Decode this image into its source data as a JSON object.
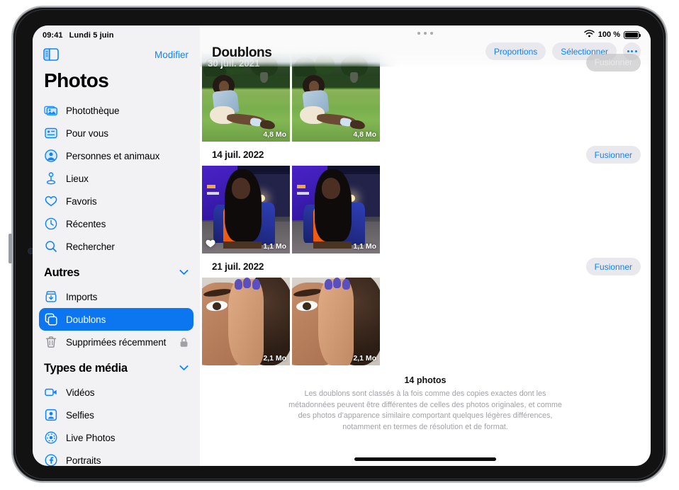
{
  "status_bar": {
    "time": "09:41",
    "date": "Lundi 5 juin",
    "battery_percent": "100 %",
    "wifi_icon": "wifi-icon",
    "battery_icon": "battery-icon"
  },
  "sidebar": {
    "toggle_icon": "sidebar-toggle-icon",
    "edit_label": "Modifier",
    "title": "Photos",
    "items": [
      {
        "label": "Photothèque",
        "icon": "photo-stack-icon",
        "selected": false
      },
      {
        "label": "Pour vous",
        "icon": "for-you-icon",
        "selected": false
      },
      {
        "label": "Personnes et animaux",
        "icon": "person-circle-icon",
        "selected": false
      },
      {
        "label": "Lieux",
        "icon": "map-pin-icon",
        "selected": false
      },
      {
        "label": "Favoris",
        "icon": "heart-icon",
        "selected": false
      },
      {
        "label": "Récentes",
        "icon": "clock-icon",
        "selected": false
      },
      {
        "label": "Rechercher",
        "icon": "search-icon",
        "selected": false
      }
    ],
    "sections": [
      {
        "title": "Autres",
        "chevron_icon": "chevron-down-icon",
        "items": [
          {
            "label": "Imports",
            "icon": "import-icon",
            "selected": false,
            "trailing_icon": null
          },
          {
            "label": "Doublons",
            "icon": "duplicate-icon",
            "selected": true,
            "trailing_icon": null
          },
          {
            "label": "Supprimées récemment",
            "icon": "trash-icon",
            "selected": false,
            "trailing_icon": "lock-icon"
          }
        ]
      },
      {
        "title": "Types de média",
        "chevron_icon": "chevron-down-icon",
        "items": [
          {
            "label": "Vidéos",
            "icon": "video-icon",
            "selected": false,
            "trailing_icon": null
          },
          {
            "label": "Selfies",
            "icon": "selfie-icon",
            "selected": false,
            "trailing_icon": null
          },
          {
            "label": "Live Photos",
            "icon": "live-photos-icon",
            "selected": false,
            "trailing_icon": null
          },
          {
            "label": "Portraits",
            "icon": "portrait-icon",
            "selected": false,
            "trailing_icon": null
          }
        ]
      }
    ]
  },
  "main": {
    "title": "Doublons",
    "multitask_icon": "multitask-handle-icon",
    "actions": {
      "proportions_label": "Proportions",
      "select_label": "Sélectionner",
      "more_icon": "more-ellipsis-icon"
    },
    "groups": [
      {
        "date": "30 juil. 2021",
        "date_on_photo": true,
        "merge_label": "Fusionner",
        "merge_dimmed": true,
        "scene": "ph-garden",
        "photos": [
          {
            "size": "4,8 Mo",
            "favorite": false
          },
          {
            "size": "4,8 Mo",
            "favorite": false
          }
        ]
      },
      {
        "date": "14 juil. 2022",
        "date_on_photo": false,
        "merge_label": "Fusionner",
        "merge_dimmed": false,
        "scene": "ph-night",
        "photos": [
          {
            "size": "1,1 Mo",
            "favorite": true
          },
          {
            "size": "1,1 Mo",
            "favorite": false
          }
        ]
      },
      {
        "date": "21 juil. 2022",
        "date_on_photo": false,
        "merge_label": "Fusionner",
        "merge_dimmed": false,
        "scene": "ph-face",
        "photos": [
          {
            "size": "2,1 Mo",
            "favorite": false
          },
          {
            "size": "2,1 Mo",
            "favorite": false
          }
        ]
      }
    ],
    "footer": {
      "count": "14 photos",
      "description": "Les doublons sont classés à la fois comme des copies exactes dont les métadonnées peuvent être différentes de celles des photos originales, et comme des photos d’apparence similaire comportant quelques légères différences, notamment en termes de résolution et de format."
    }
  },
  "colors": {
    "accent": "#0a84ff",
    "selected_row": "#0b76ef",
    "sidebar_bg": "#f2f2f5",
    "pill_bg": "#e8e8ed"
  }
}
